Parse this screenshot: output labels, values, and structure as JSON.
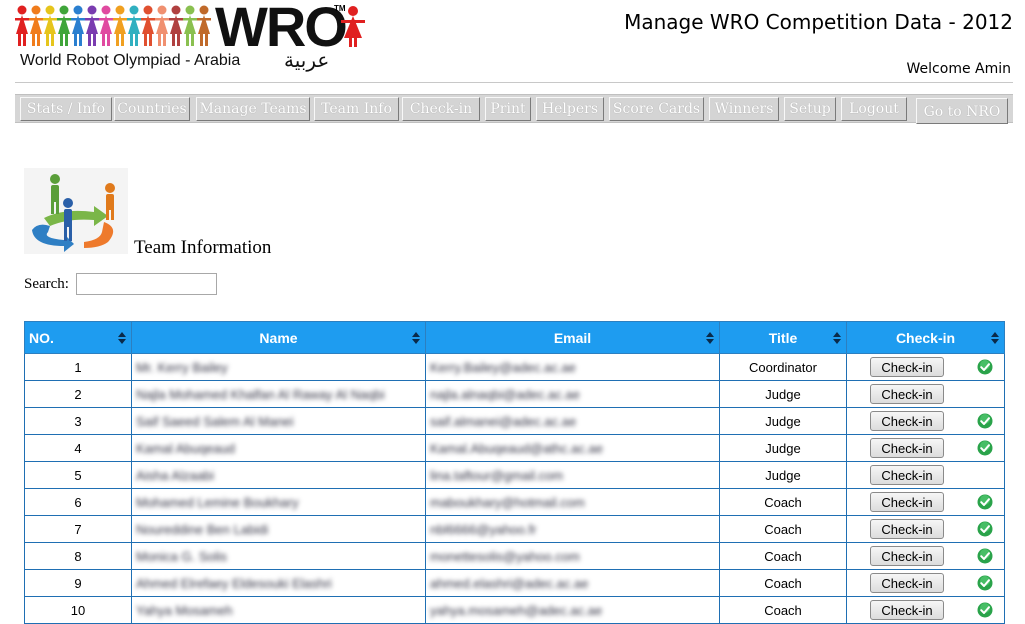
{
  "header": {
    "logo_text": "WRO",
    "logo_tm": "TM",
    "logo_subtitle": "World Robot Olympiad  -  Arabia",
    "logo_arabic": "عربية",
    "app_title": "Manage WRO Competition Data - 2012",
    "welcome": "Welcome Amin"
  },
  "nav": {
    "items": [
      {
        "label": "Stats / Info"
      },
      {
        "label": "Countries"
      },
      {
        "label": "Manage Teams"
      },
      {
        "label": "Team Info"
      },
      {
        "label": "Check-in"
      },
      {
        "label": "Print"
      },
      {
        "label": "Helpers"
      },
      {
        "label": "Score Cards"
      },
      {
        "label": "Winners"
      },
      {
        "label": "Setup"
      },
      {
        "label": "Logout"
      },
      {
        "label": "Go to NRO"
      }
    ]
  },
  "section": {
    "title": "Team Information",
    "search_label": "Search:",
    "search_value": ""
  },
  "table": {
    "headers": [
      "NO.",
      "Name",
      "Email",
      "Title",
      "Check-in"
    ],
    "button_label": "Check-in",
    "rows": [
      {
        "no": "1",
        "name": "Mr. Kerry Bailey",
        "email": "Kerry.Bailey@adec.ac.ae",
        "title": "Coordinator",
        "checked": true
      },
      {
        "no": "2",
        "name": "Najla Mohamed Khalfan Al Raway Al Naqbi",
        "email": "najla.alnaqbi@adec.ac.ae",
        "title": "Judge",
        "checked": false
      },
      {
        "no": "3",
        "name": "Saif Saeed Salem Al Manei",
        "email": "saif.almanei@adec.ac.ae",
        "title": "Judge",
        "checked": true
      },
      {
        "no": "4",
        "name": "Kamal Abuqeaud",
        "email": "Kamal.Abuqeaud@athc.ac.ae",
        "title": "Judge",
        "checked": true
      },
      {
        "no": "5",
        "name": "Aisha Alzaabi",
        "email": "lina.taftour@gmail.com",
        "title": "Judge",
        "checked": false
      },
      {
        "no": "6",
        "name": "Mohamed Lemine Boukhary",
        "email": "maboukhary@hotmail.com",
        "title": "Coach",
        "checked": true
      },
      {
        "no": "7",
        "name": "Noureddine Ben Labidi",
        "email": "nbl6666@yahoo.fr",
        "title": "Coach",
        "checked": true
      },
      {
        "no": "8",
        "name": "Monica G. Solis",
        "email": "monettesolis@yahoo.com",
        "title": "Coach",
        "checked": true
      },
      {
        "no": "9",
        "name": "Ahmed Elrefaey Eldesouki Elashri",
        "email": "ahmed.elashri@adec.ac.ae",
        "title": "Coach",
        "checked": true
      },
      {
        "no": "10",
        "name": "Yahya Mosameh",
        "email": "yahya.mosameh@adec.ac.ae",
        "title": "Coach",
        "checked": true
      }
    ]
  },
  "colors": {
    "header_bg": "#1e9cf0",
    "nav_bg": "#d6d6d6",
    "check_ok": "#2aa34a",
    "row_border": "#1f6fb3"
  },
  "icons": [
    "people-chain-logo-icon",
    "team-cycle-icon",
    "sort-arrows-icon",
    "check-ok-icon"
  ]
}
